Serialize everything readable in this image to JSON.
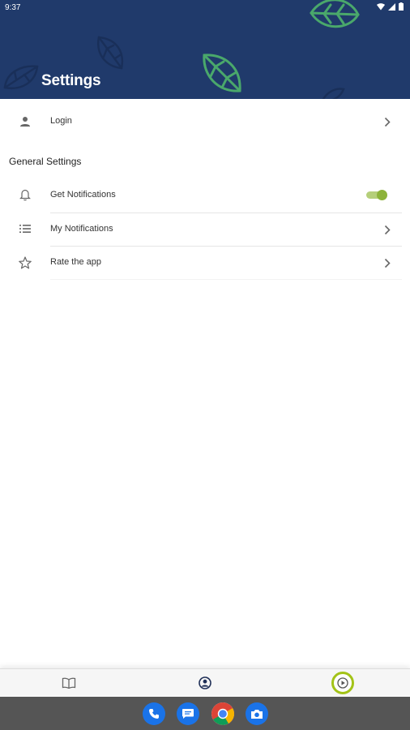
{
  "status_bar": {
    "time": "9:37",
    "icons": [
      "wifi-icon",
      "signal-icon",
      "battery-icon"
    ]
  },
  "header": {
    "title": "Settings",
    "background_color": "#203a6b",
    "decoration": "leaf-icon"
  },
  "account": {
    "login_label": "Login",
    "icon": "person-icon"
  },
  "general_settings": {
    "title": "General Settings",
    "items": [
      {
        "label": "Get Notifications",
        "icon": "bell-icon",
        "control": "toggle",
        "toggle_on": true
      },
      {
        "label": "My Notifications",
        "icon": "list-icon",
        "control": "chevron"
      },
      {
        "label": "Rate the app",
        "icon": "star-icon",
        "control": "chevron"
      }
    ]
  },
  "bottom_nav": {
    "items": [
      {
        "icon": "book-icon",
        "active": false
      },
      {
        "icon": "account-circle-icon",
        "active": false
      },
      {
        "icon": "play-circle-icon",
        "active": true
      }
    ],
    "accent_color": "#a3c318"
  },
  "dock": {
    "apps": [
      "phone-icon",
      "messages-icon",
      "chrome-icon",
      "camera-icon"
    ]
  }
}
